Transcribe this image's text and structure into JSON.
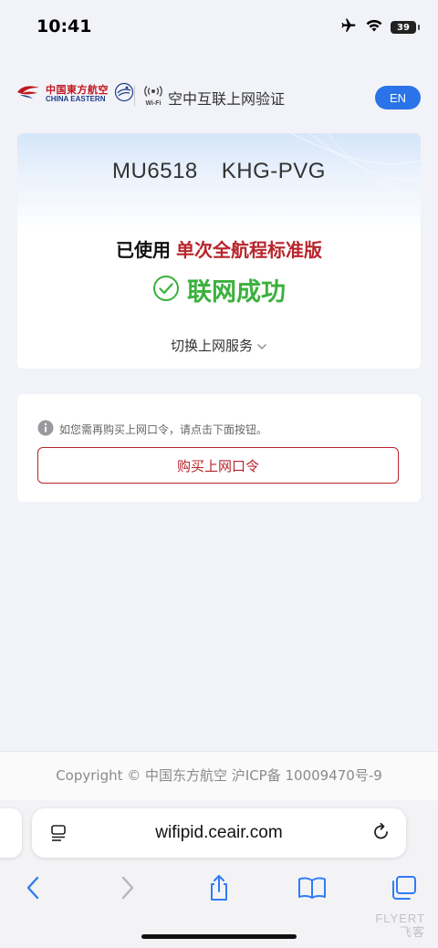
{
  "status_bar": {
    "time": "10:41",
    "battery": "39"
  },
  "header": {
    "logo_cn": "中国東方航空",
    "logo_en": "CHINA EASTERN",
    "wifi_label": "Wi-Fi",
    "title": "空中互联上网验证",
    "lang_button": "EN"
  },
  "flight": {
    "number": "MU6518",
    "route": "KHG-PVG",
    "package_prefix": "已使用",
    "package_name": "单次全航程标准版",
    "status": "联网成功",
    "switch_service": "切换上网服务"
  },
  "purchase": {
    "hint": "如您需再购买上网口令，请点击下面按钮。",
    "button": "购买上网口令"
  },
  "footer": {
    "copyright": "Copyright © 中国东方航空 沪ICP备 10009470号-9"
  },
  "browser": {
    "url": "wifipid.ceair.com"
  },
  "watermark": {
    "line1": "FLYERT",
    "line2": "飞客"
  },
  "colors": {
    "brand_red": "#b8242b",
    "success_green": "#3bb13d",
    "accent_blue": "#2a73e8",
    "ios_blue": "#2f7cf6"
  }
}
